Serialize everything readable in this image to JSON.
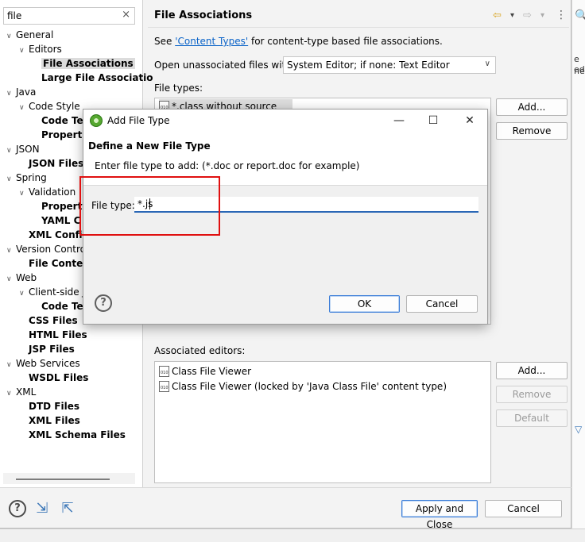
{
  "filter": {
    "value": "file",
    "clear_glyph": "×"
  },
  "tree": [
    {
      "label": "General",
      "arrow": "∨",
      "level": 0,
      "bold": false
    },
    {
      "label": "Editors",
      "arrow": "∨",
      "level": 1,
      "bold": false
    },
    {
      "label": "File Associations",
      "arrow": "",
      "level": 2,
      "bold": true,
      "selected": true
    },
    {
      "label": "Large File Associatio",
      "arrow": "",
      "level": 2,
      "bold": true
    },
    {
      "label": "Java",
      "arrow": "∨",
      "level": 0,
      "bold": false
    },
    {
      "label": "Code Style",
      "arrow": "∨",
      "level": 1,
      "bold": false
    },
    {
      "label": "Code Te",
      "arrow": "",
      "level": 2,
      "bold": true
    },
    {
      "label": "Properties",
      "arrow": "",
      "level": 2,
      "bold": true
    },
    {
      "label": "JSON",
      "arrow": "∨",
      "level": 0,
      "bold": false
    },
    {
      "label": "JSON Files",
      "arrow": "",
      "level": 1,
      "bold": true
    },
    {
      "label": "Spring",
      "arrow": "∨",
      "level": 0,
      "bold": false
    },
    {
      "label": "Validation",
      "arrow": "∨",
      "level": 1,
      "bold": false
    },
    {
      "label": "Property",
      "arrow": "",
      "level": 2,
      "bold": true
    },
    {
      "label": "YAML C",
      "arrow": "",
      "level": 2,
      "bold": true
    },
    {
      "label": "XML Config",
      "arrow": "",
      "level": 1,
      "bold": true
    },
    {
      "label": "Version Contro",
      "arrow": "∨",
      "level": 0,
      "bold": false
    },
    {
      "label": "File Conten",
      "arrow": "",
      "level": 1,
      "bold": true
    },
    {
      "label": "Web",
      "arrow": "∨",
      "level": 0,
      "bold": false
    },
    {
      "label": "Client-side J",
      "arrow": "∨",
      "level": 1,
      "bold": false
    },
    {
      "label": "Code Te",
      "arrow": "",
      "level": 2,
      "bold": true
    },
    {
      "label": "CSS Files",
      "arrow": "",
      "level": 1,
      "bold": true
    },
    {
      "label": "HTML Files",
      "arrow": "",
      "level": 1,
      "bold": true
    },
    {
      "label": "JSP Files",
      "arrow": "",
      "level": 1,
      "bold": true
    },
    {
      "label": "Web Services",
      "arrow": "∨",
      "level": 0,
      "bold": false
    },
    {
      "label": "WSDL Files",
      "arrow": "",
      "level": 1,
      "bold": true
    },
    {
      "label": "XML",
      "arrow": "∨",
      "level": 0,
      "bold": false
    },
    {
      "label": "DTD Files",
      "arrow": "",
      "level": 1,
      "bold": true
    },
    {
      "label": "XML Files",
      "arrow": "",
      "level": 1,
      "bold": true
    },
    {
      "label": "XML Schema Files",
      "arrow": "",
      "level": 1,
      "bold": true
    }
  ],
  "page": {
    "title": "File Associations",
    "nav": {
      "back": "⇦",
      "back_menu": "▾",
      "forward": "⇨",
      "forward_menu": "▾",
      "more": "⋮"
    },
    "see_prefix": "See ",
    "see_link": "'Content Types'",
    "see_suffix": " for content-type based file associations.",
    "unassociated_label": "Open unassociated files with:",
    "unassociated_value": "System Editor; if none: Text Editor",
    "file_types_label": "File types:",
    "file_types_partial_row": "*.class without source",
    "file_types_buttons": {
      "add": "Add...",
      "remove": "Remove"
    },
    "associated_label": "Associated editors:",
    "associated_editors": [
      "Class File Viewer",
      "Class File Viewer (locked by 'Java Class File' content type)"
    ],
    "editor_buttons": {
      "add": "Add...",
      "remove": "Remove",
      "default": "Default"
    }
  },
  "dialog": {
    "title": "Add File Type",
    "minimize": "—",
    "maximize": "☐",
    "close": "✕",
    "heading": "Define a New File Type",
    "description": "Enter file type to add: (*.doc or report.doc for example)",
    "field_label": "File type:",
    "field_value": "*.js",
    "help": "?",
    "ok": "OK",
    "cancel": "Cancel"
  },
  "footer": {
    "apply_close": "Apply and Close",
    "cancel": "Cancel"
  },
  "background_fragments": {
    "search_glyph": "🔍",
    "frag1": "e ed",
    "frag2": "ne."
  },
  "colors": {
    "highlight": "#e01010",
    "link": "#0a63c8",
    "focus": "#2a67b6",
    "spring_green": "#56a830"
  }
}
